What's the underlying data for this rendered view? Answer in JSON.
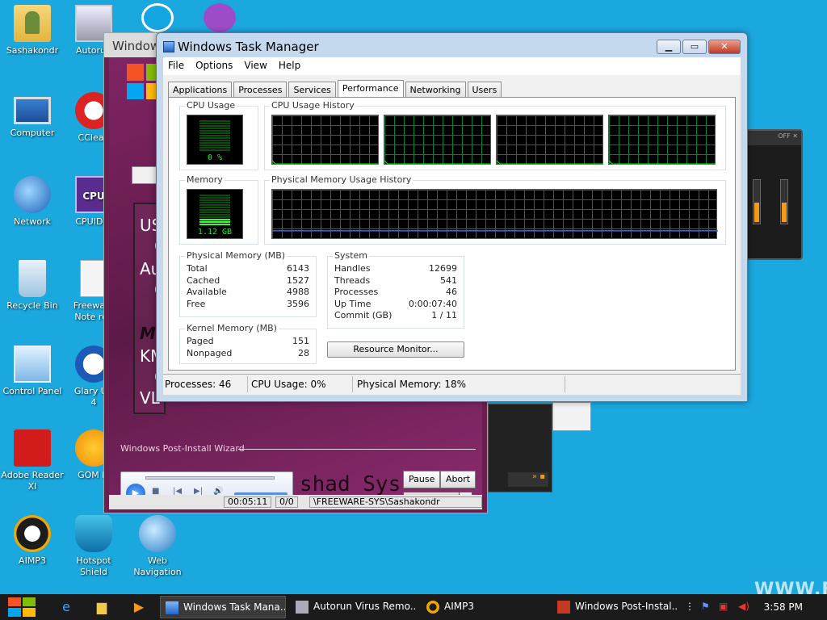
{
  "desktop": {
    "icons": [
      {
        "label": "Sashakondr",
        "label2": ""
      },
      {
        "label": "Computer",
        "label2": ""
      },
      {
        "label": "Network",
        "label2": ""
      },
      {
        "label": "Recycle Bin",
        "label2": ""
      },
      {
        "label": "Control Panel",
        "label2": ""
      },
      {
        "label": "Adobe Reader",
        "label2": "XI"
      },
      {
        "label": "AIMP3",
        "label2": ""
      },
      {
        "label": "Autorun",
        "label2": ""
      },
      {
        "label": "CClean",
        "label2": ""
      },
      {
        "label": "CPUID C",
        "label2": ""
      },
      {
        "label": "Freeware",
        "label2": "Note rea"
      },
      {
        "label": "Glary Uti",
        "label2": "4"
      },
      {
        "label": "GOM Pl",
        "label2": ""
      },
      {
        "label": "Hotspot",
        "label2": "Shield"
      },
      {
        "label": "Web",
        "label2": "Navigation"
      }
    ],
    "watermark": "WWW.FR"
  },
  "wizard": {
    "title": "Window",
    "panel_lines": [
      "US",
      "C",
      "Au",
      "C",
      "M",
      "KM",
      "C",
      "VL"
    ],
    "section_label": "Windows Post-Install Wizard",
    "brand_text": "shad Sys",
    "pause_label": "Pause",
    "abort_label": "Abort",
    "status": {
      "time": "00:05:11",
      "count": "0/0",
      "path": "\\FREEWARE-SYS\\Sashakondr"
    }
  },
  "aimp": {
    "off_label": "OFF"
  },
  "task_manager": {
    "title": "Windows Task Manager",
    "menu": [
      "File",
      "Options",
      "View",
      "Help"
    ],
    "tabs": [
      "Applications",
      "Processes",
      "Services",
      "Performance",
      "Networking",
      "Users"
    ],
    "active_tab": "Performance",
    "cpu_usage": {
      "label": "CPU Usage",
      "value": "0 %",
      "percent": 0
    },
    "cpu_history": {
      "label": "CPU Usage History",
      "cores": 4
    },
    "memory": {
      "label": "Memory",
      "value": "1.12 GB",
      "percent": 18
    },
    "memory_history": {
      "label": "Physical Memory Usage History"
    },
    "physical_memory": {
      "label": "Physical Memory (MB)",
      "rows": [
        {
          "key": "Total",
          "value": "6143"
        },
        {
          "key": "Cached",
          "value": "1527"
        },
        {
          "key": "Available",
          "value": "4988"
        },
        {
          "key": "Free",
          "value": "3596"
        }
      ]
    },
    "kernel_memory": {
      "label": "Kernel Memory (MB)",
      "rows": [
        {
          "key": "Paged",
          "value": "151"
        },
        {
          "key": "Nonpaged",
          "value": "28"
        }
      ]
    },
    "system": {
      "label": "System",
      "rows": [
        {
          "key": "Handles",
          "value": "12699"
        },
        {
          "key": "Threads",
          "value": "541"
        },
        {
          "key": "Processes",
          "value": "46"
        },
        {
          "key": "Up Time",
          "value": "0:00:07:40"
        },
        {
          "key": "Commit (GB)",
          "value": "1 / 11"
        }
      ]
    },
    "resource_monitor_label": "Resource Monitor...",
    "status_bar": {
      "processes": "Processes: 46",
      "cpu": "CPU Usage: 0%",
      "memory": "Physical Memory: 18%"
    }
  },
  "taskbar": {
    "items": [
      {
        "label": "Windows Task Mana...",
        "active": true
      },
      {
        "label": "Autorun Virus Remo...",
        "active": false
      },
      {
        "label": "AIMP3",
        "active": false
      },
      {
        "label": "Windows Post-Instal...",
        "active": false
      }
    ],
    "clock": "3:58 PM"
  },
  "colors": {
    "desktop_bg": "#1ba8de",
    "graph_grid": "#008040",
    "graph_line": "#00ff00",
    "memory_line": "#2a6df0",
    "taskbar_bg": "#1b1b1b"
  }
}
